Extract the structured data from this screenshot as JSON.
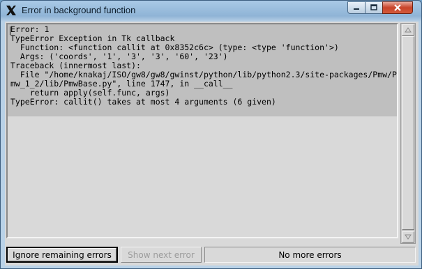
{
  "window": {
    "title": "Error in background function"
  },
  "traceback_lines": [
    "Error: 1",
    "TypeError Exception in Tk callback",
    "  Function: <function callit at 0x8352c6c> (type: <type 'function'>)",
    "  Args: ('coords', '1', '3', '3', '60', '23')",
    "Traceback (innermost last):",
    "  File \"/home/knakaj/ISO/gw8/gw8/gwinst/python/lib/python2.3/site-packages/Pmw/P",
    "mw_1_2/lib/PmwBase.py\", line 1747, in __call__",
    "    return apply(self.func, args)",
    "TypeError: callit() takes at most 4 arguments (6 given)"
  ],
  "buttons": {
    "ignore": "Ignore remaining errors",
    "next": "Show next error",
    "status": "No more errors"
  },
  "colors": {
    "title_bar": "#a9c9e6",
    "close_button": "#c8432a",
    "text_highlight": "#bfbfbf"
  }
}
